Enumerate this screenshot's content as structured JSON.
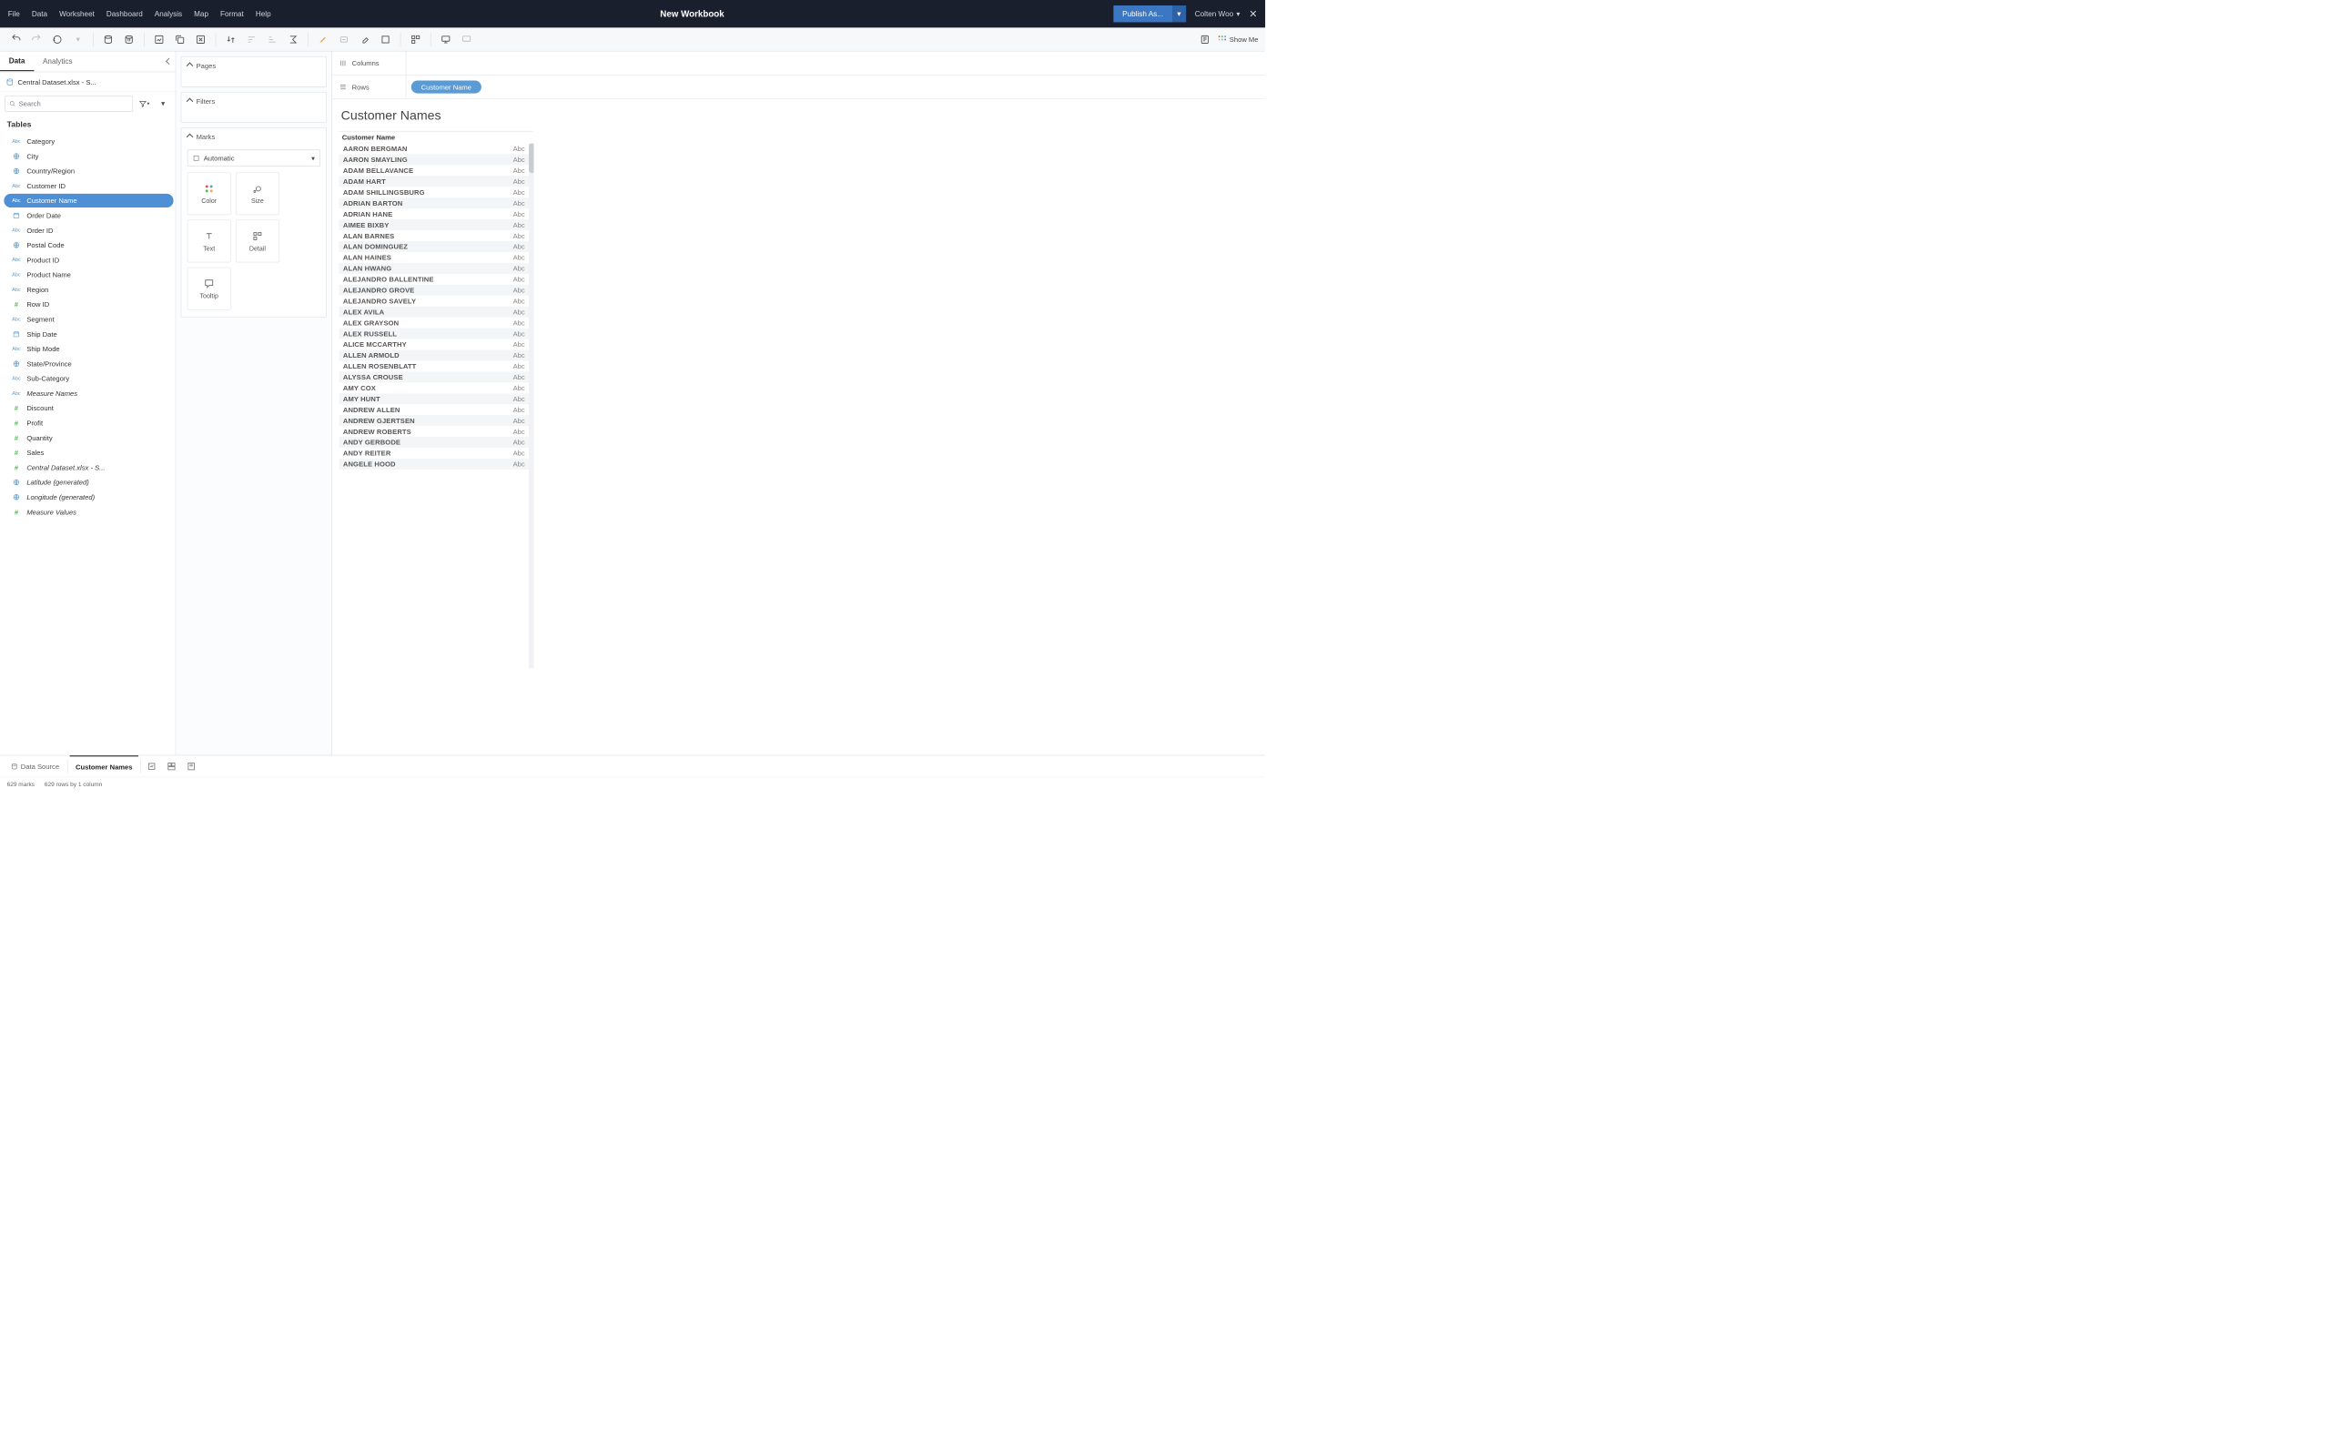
{
  "titlebar": {
    "menus": [
      "File",
      "Data",
      "Worksheet",
      "Dashboard",
      "Analysis",
      "Map",
      "Format",
      "Help"
    ],
    "workbook": "New Workbook",
    "publish": "Publish As...",
    "user": "Colten Woo"
  },
  "toolbar": {
    "showme": "Show Me"
  },
  "sidebar": {
    "tabs": {
      "data": "Data",
      "analytics": "Analytics"
    },
    "datasource": "Central Dataset.xlsx - S...",
    "search_placeholder": "Search",
    "tables_header": "Tables",
    "fields": [
      {
        "label": "Category",
        "type": "abc"
      },
      {
        "label": "City",
        "type": "geo"
      },
      {
        "label": "Country/Region",
        "type": "geo"
      },
      {
        "label": "Customer ID",
        "type": "abc"
      },
      {
        "label": "Customer Name",
        "type": "abc",
        "selected": true
      },
      {
        "label": "Order Date",
        "type": "date"
      },
      {
        "label": "Order ID",
        "type": "abc"
      },
      {
        "label": "Postal Code",
        "type": "geo"
      },
      {
        "label": "Product ID",
        "type": "abc"
      },
      {
        "label": "Product Name",
        "type": "abc"
      },
      {
        "label": "Region",
        "type": "abc"
      },
      {
        "label": "Row ID",
        "type": "num"
      },
      {
        "label": "Segment",
        "type": "abc"
      },
      {
        "label": "Ship Date",
        "type": "date"
      },
      {
        "label": "Ship Mode",
        "type": "abc"
      },
      {
        "label": "State/Province",
        "type": "geo"
      },
      {
        "label": "Sub-Category",
        "type": "abc"
      },
      {
        "label": "Measure Names",
        "type": "abc",
        "italic": true
      },
      {
        "label": "Discount",
        "type": "num"
      },
      {
        "label": "Profit",
        "type": "num"
      },
      {
        "label": "Quantity",
        "type": "num"
      },
      {
        "label": "Sales",
        "type": "num"
      },
      {
        "label": "Central Dataset.xlsx - S...",
        "type": "num",
        "italic": true
      },
      {
        "label": "Latitude (generated)",
        "type": "geo",
        "italic": true
      },
      {
        "label": "Longitude (generated)",
        "type": "geo",
        "italic": true
      },
      {
        "label": "Measure Values",
        "type": "num",
        "italic": true
      }
    ]
  },
  "shelves": {
    "pages": "Pages",
    "filters": "Filters",
    "marks": "Marks",
    "marks_type": "Automatic",
    "cards": {
      "color": "Color",
      "size": "Size",
      "text": "Text",
      "detail": "Detail",
      "tooltip": "Tooltip"
    },
    "columns": "Columns",
    "rows": "Rows",
    "rows_pill": "Customer Name"
  },
  "viz": {
    "title": "Customer Names",
    "header": "Customer Name",
    "abc": "Abc",
    "names": [
      "AARON BERGMAN",
      "AARON SMAYLING",
      "ADAM BELLAVANCE",
      "ADAM HART",
      "ADAM SHILLINGSBURG",
      "ADRIAN BARTON",
      "ADRIAN HANE",
      "AIMEE BIXBY",
      "ALAN BARNES",
      "ALAN DOMINGUEZ",
      "ALAN HAINES",
      "ALAN HWANG",
      "ALEJANDRO BALLENTINE",
      "ALEJANDRO GROVE",
      "ALEJANDRO SAVELY",
      "ALEX AVILA",
      "ALEX GRAYSON",
      "ALEX RUSSELL",
      "ALICE MCCARTHY",
      "ALLEN ARMOLD",
      "ALLEN ROSENBLATT",
      "ALYSSA CROUSE",
      "AMY COX",
      "AMY HUNT",
      "ANDREW ALLEN",
      "ANDREW GJERTSEN",
      "ANDREW ROBERTS",
      "ANDY GERBODE",
      "ANDY REITER",
      "ANGELE HOOD"
    ]
  },
  "bottom": {
    "datasource": "Data Source",
    "sheet": "Customer Names"
  },
  "status": {
    "marks": "629 marks",
    "rows": "629 rows by 1 column"
  }
}
